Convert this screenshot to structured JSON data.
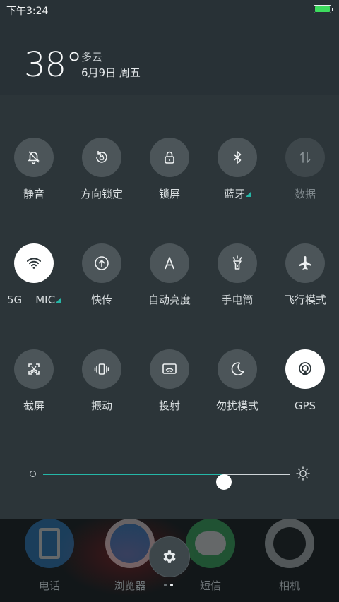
{
  "status_bar": {
    "time": "下午3:24"
  },
  "weather": {
    "temperature": "38°",
    "condition": "多云",
    "date": "6月9日 周五"
  },
  "tiles": [
    {
      "label": "静音",
      "icon": "bell-off-icon",
      "state": "off"
    },
    {
      "label": "方向锁定",
      "icon": "rotation-lock-icon",
      "state": "off"
    },
    {
      "label": "锁屏",
      "icon": "lock-icon",
      "state": "off"
    },
    {
      "label": "蓝牙",
      "icon": "bluetooth-icon",
      "state": "off",
      "expandable": true
    },
    {
      "label": "数据",
      "icon": "data-transfer-icon",
      "state": "disabled"
    },
    {
      "label": "5G    MIC",
      "icon": "wifi-icon",
      "state": "on",
      "expandable": true
    },
    {
      "label": "快传",
      "icon": "quick-transfer-icon",
      "state": "off"
    },
    {
      "label": "自动亮度",
      "icon": "auto-brightness-icon",
      "state": "off"
    },
    {
      "label": "手电筒",
      "icon": "flashlight-icon",
      "state": "off"
    },
    {
      "label": "飞行模式",
      "icon": "airplane-icon",
      "state": "off"
    },
    {
      "label": "截屏",
      "icon": "screenshot-icon",
      "state": "off"
    },
    {
      "label": "振动",
      "icon": "vibrate-icon",
      "state": "off"
    },
    {
      "label": "投射",
      "icon": "cast-icon",
      "state": "off"
    },
    {
      "label": "勿扰模式",
      "icon": "moon-icon",
      "state": "off"
    },
    {
      "label": "GPS",
      "icon": "gps-icon",
      "state": "on"
    }
  ],
  "brightness": {
    "level": 0.73
  },
  "dock": [
    {
      "label": "电话",
      "icon": "phone-app-icon"
    },
    {
      "label": "浏览器",
      "icon": "browser-app-icon"
    },
    {
      "label": "短信",
      "icon": "messages-app-icon"
    },
    {
      "label": "相机",
      "icon": "camera-app-icon"
    }
  ],
  "page_indicator": {
    "count": 2,
    "active": 1
  },
  "colors": {
    "accent": "#25b7a8",
    "tile_off": "#4c5559",
    "tile_on": "#ffffff",
    "panel_bg": "#2c3539"
  }
}
